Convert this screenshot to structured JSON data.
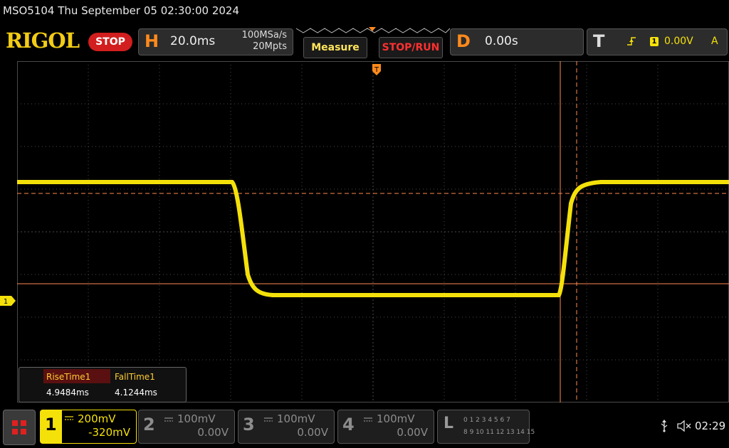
{
  "header": {
    "model_datetime": "MSO5104  Thu September 05 02:30:00 2024",
    "brand": "RIGOL",
    "run_state": "STOP",
    "horizontal": {
      "letter": "H",
      "timebase": "20.0ms",
      "sample_rate": "100MSa/s",
      "memory_depth": "20Mpts"
    },
    "measure_button": "Measure",
    "stop_run_button": "STOP/RUN",
    "delay": {
      "letter": "D",
      "value": "0.00s"
    },
    "trigger": {
      "letter": "T",
      "source_badge": "1",
      "level": "0.00V",
      "mode": "A"
    }
  },
  "screen": {
    "channel1_marker": "1",
    "trigger_marker_label": "T",
    "colors": {
      "trace": "#f5e10a",
      "cursor": "#ff8a50",
      "grid": "#4a4a4a",
      "accent": "#ff8a1c"
    }
  },
  "measurements": [
    {
      "label": "RiseTime1",
      "value": "4.9484ms"
    },
    {
      "label": "FallTime1",
      "value": "4.1244ms"
    }
  ],
  "channels": [
    {
      "num": "1",
      "scale": "200mV",
      "offset": "-320mV",
      "active": true
    },
    {
      "num": "2",
      "scale": "100mV",
      "offset": "0.00V",
      "active": false
    },
    {
      "num": "3",
      "scale": "100mV",
      "offset": "0.00V",
      "active": false
    },
    {
      "num": "4",
      "scale": "100mV",
      "offset": "0.00V",
      "active": false
    }
  ],
  "logic": {
    "letter": "L",
    "row1": "0 1 2 3   4 5 6 7",
    "row2": "8 9 10 11 12 13 14 15"
  },
  "status": {
    "time": "02:29",
    "icons": [
      "usb-icon",
      "speaker-muted-icon"
    ]
  }
}
